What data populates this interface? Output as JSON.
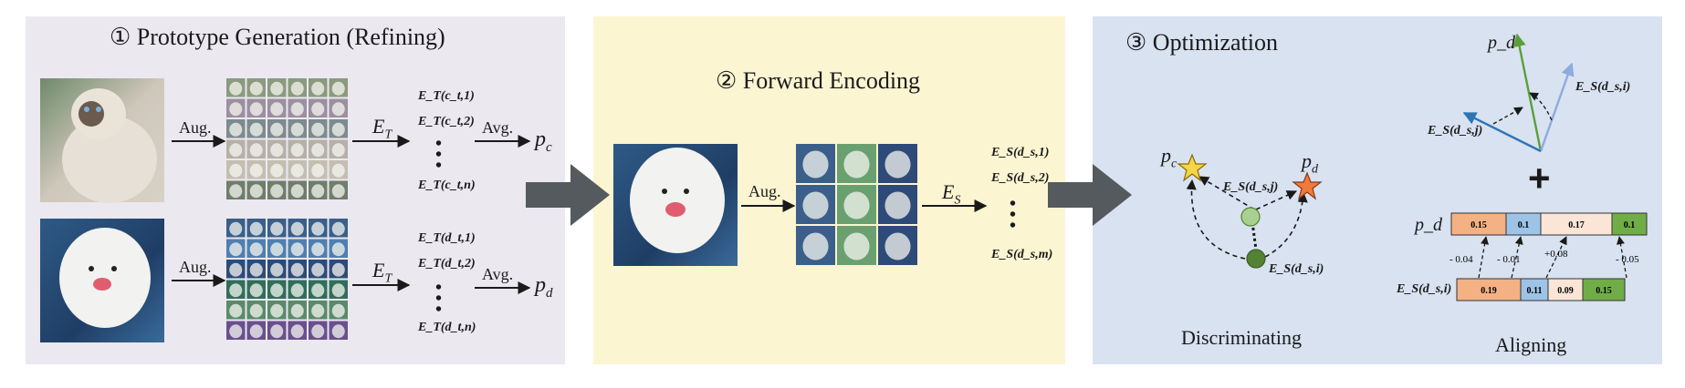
{
  "panel1": {
    "title": "① Prototype Generation (Refining)",
    "aug1": "Aug.",
    "aug2": "Aug.",
    "et1": "E",
    "et1_sub": "T",
    "et2": "E",
    "et2_sub": "T",
    "avg1": "Avg.",
    "avg2": "Avg.",
    "pc": "p",
    "pc_sub": "c",
    "pd": "p",
    "pd_sub": "d",
    "list_c": [
      "E_T(c_t,1)",
      "E_T(c_t,2)",
      "E_T(c_t,n)"
    ],
    "list_d": [
      "E_T(d_t,1)",
      "E_T(d_t,2)",
      "E_T(d_t,n)"
    ]
  },
  "panel2": {
    "title": "② Forward Encoding",
    "aug": "Aug.",
    "es": "E",
    "es_sub": "S",
    "list": [
      "E_S(d_s,1)",
      "E_S(d_s,2)",
      "E_S(d_s,m)"
    ]
  },
  "panel3": {
    "title": "③ Optimization",
    "pc": "p",
    "pc_sub": "c",
    "pd": "p",
    "pd_sub": "d",
    "es_dsj": "E_S(d_s,j)",
    "es_dsi": "E_S(d_s,i)",
    "discriminating": "Discriminating",
    "aligning": "Aligning",
    "vec_pd": "p_d",
    "vec_esi": "E_S(d_s,i)",
    "vec_esj": "E_S(d_s,j)",
    "plus": "+",
    "bar_pd_label": "p_d",
    "bar_es_label": "E_S(d_s,i)",
    "bar_pd_values": [
      "0.15",
      "0.1",
      "0.17",
      "0.1"
    ],
    "bar_es_values": [
      "0.19",
      "0.11",
      "0.09",
      "0.15"
    ],
    "diffs": [
      "- 0.04",
      "- 0.01",
      "+0.08",
      "- 0.05"
    ]
  },
  "colors": {
    "panel1_bg": "#ebe8f0",
    "panel2_bg": "#fcf5d2",
    "panel3_bg": "#d8e2f1",
    "big_arrow": "#555a5e",
    "star_c": "#f5d547",
    "star_d": "#f07a3a",
    "node_light": "#a9d08e",
    "node_dark": "#548235",
    "bar_orange": "#f4b183",
    "bar_blue": "#9dc3e6",
    "bar_cream": "#fbe5d6",
    "bar_green": "#70ad47"
  }
}
